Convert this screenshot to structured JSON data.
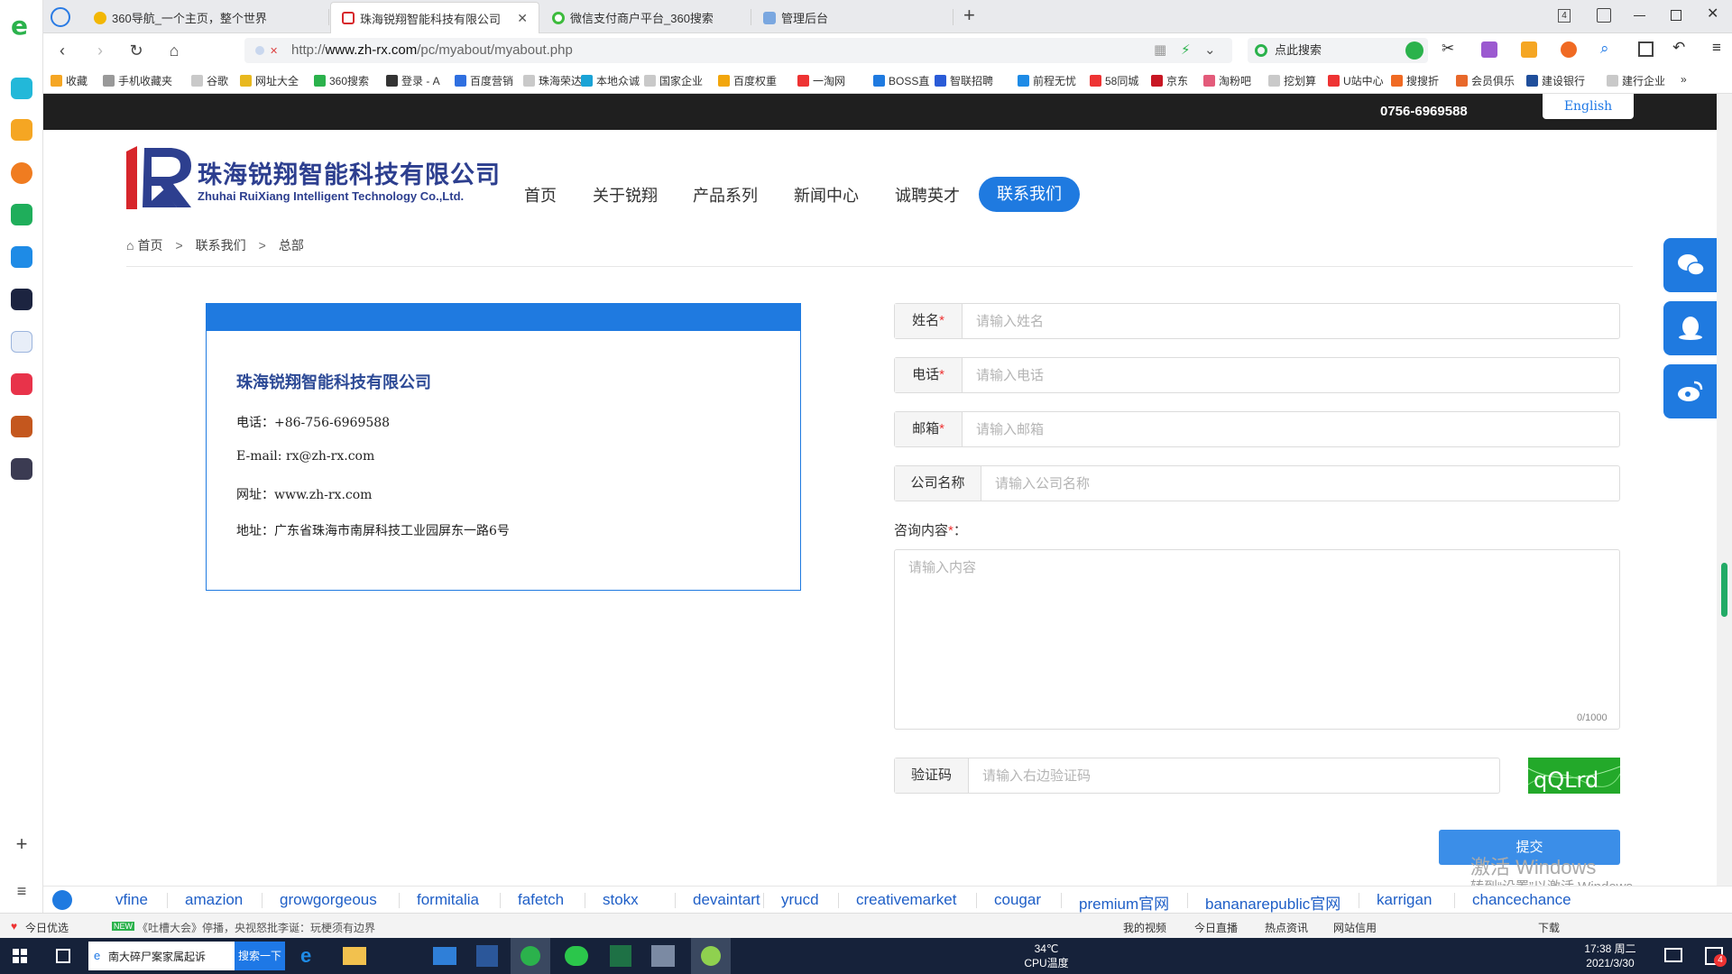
{
  "browser": {
    "tabs": [
      {
        "label": "360导航_一个主页，整个世界",
        "active": false
      },
      {
        "label": "珠海锐翔智能科技有限公司",
        "active": true
      },
      {
        "label": "微信支付商户平台_360搜索",
        "active": false
      },
      {
        "label": "管理后台",
        "active": false
      }
    ],
    "new_tab": "+",
    "tab_count_badge": "4",
    "url_prefix": "http://",
    "url_domain": "www.zh-rx.com",
    "url_path": "/pc/myabout/myabout.php",
    "search_placeholder": "点此搜索",
    "bookmarks": [
      "收藏",
      "手机收藏夹",
      "谷歌",
      "网址大全",
      "360搜索",
      "登录 - A",
      "百度营销",
      "珠海荣达",
      "本地众诚",
      "国家企业",
      "百度权重",
      "一淘网",
      "BOSS直",
      "智联招聘",
      "前程无忧",
      "58同城",
      "京东",
      "淘粉吧",
      "挖划算",
      "U站中心",
      "搜搜折",
      "会员俱乐",
      "建设银行",
      "建行企业"
    ],
    "bookmarks_more": "»"
  },
  "site": {
    "phone": "0756-6969588",
    "english_button": "English",
    "logo_cn": "珠海锐翔智能科技有限公司",
    "logo_en": "Zhuhai RuiXiang Intelligent Technology Co.,Ltd.",
    "nav": [
      "首页",
      "关于锐翔",
      "产品系列",
      "新闻中心",
      "诚聘英才"
    ],
    "nav_active": "联系我们",
    "breadcrumb": [
      "首页",
      "联系我们",
      "总部"
    ],
    "breadcrumb_sep": ">",
    "card": {
      "title": "珠海锐翔智能科技有限公司",
      "phone": "电话：+86-756-6969588",
      "email": "E-mail: rx@zh-rx.com",
      "website": "网址：www.zh-rx.com",
      "address": "地址：广东省珠海市南屏科技工业园屏东一路6号"
    },
    "form": {
      "name_label": "姓名",
      "name_placeholder": "请输入姓名",
      "phone_label": "电话",
      "phone_placeholder": "请输入电话",
      "email_label": "邮箱",
      "email_placeholder": "请输入邮箱",
      "company_label": "公司名称",
      "company_placeholder": "请输入公司名称",
      "required_mark": "*",
      "message_label": "咨询内容",
      "message_label_suffix": "：",
      "message_placeholder": "请输入内容",
      "message_count": "0/1000",
      "captcha_label": "验证码",
      "captcha_placeholder": "请输入右边验证码",
      "captcha_text": "qQLrd",
      "submit": "提交"
    }
  },
  "watermark": {
    "line1": "激活 Windows",
    "line2": "转到“设置”以激活 Windows。"
  },
  "link_bar": [
    "vfine",
    "amazion",
    "growgorgeous",
    "formitalia",
    "fafetch",
    "stokx",
    "devaintart",
    "yrucd",
    "creativemarket",
    "cougar",
    "premium官网",
    "bananarepublic官网",
    "karrigan",
    "chancechance"
  ],
  "status_bar": {
    "left": "今日优选",
    "news_badge": "NEW",
    "news": "《吐槽大会》停播，央视怒批李诞：玩梗须有边界",
    "right": [
      "我的视频",
      "今日直播",
      "热点资讯",
      "网站信用",
      "下载"
    ]
  },
  "taskbar": {
    "search_text": "南大碎尸案家属起诉",
    "search_button": "搜索一下",
    "cpu_temp": "34℃",
    "cpu_label": "CPU温度",
    "time": "17:38 周二",
    "date": "2021/3/30",
    "notif_count": "4"
  },
  "colors": {
    "brand_blue": "#1f7ae0",
    "logo_navy": "#2d3f8f",
    "logo_red": "#d7262b",
    "captcha_green": "#23a92a",
    "taskbar": "#16223a"
  }
}
